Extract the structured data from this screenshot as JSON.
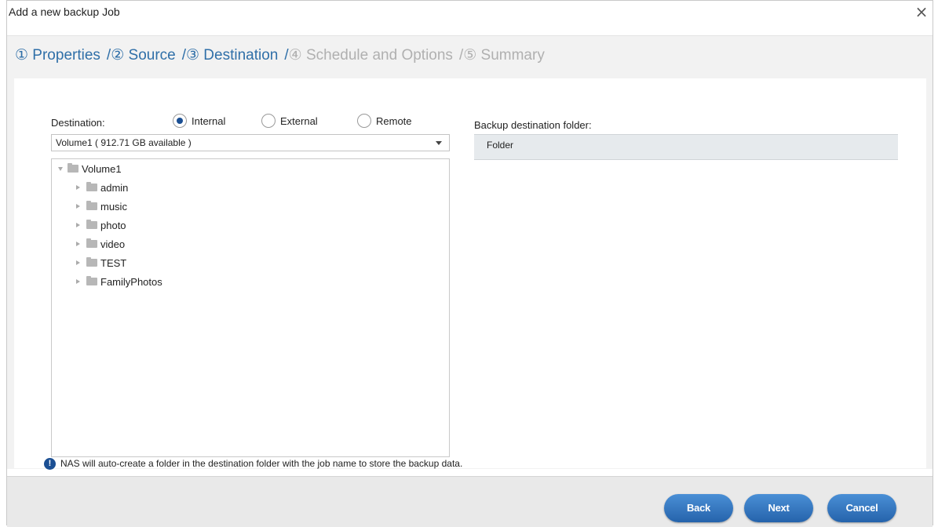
{
  "dialog": {
    "title": "Add a new backup Job",
    "close_symbol": "×"
  },
  "steps": [
    {
      "label": "① Properties",
      "state": "done"
    },
    {
      "label": "② Source",
      "state": "done"
    },
    {
      "label": "③ Destination",
      "state": "active"
    },
    {
      "label": "④ Schedule and Options",
      "state": "future"
    },
    {
      "label": "⑤ Summary",
      "state": "future"
    }
  ],
  "separator": "/",
  "destination": {
    "label": "Destination:",
    "options": [
      {
        "label": "Internal",
        "selected": true
      },
      {
        "label": "External",
        "selected": false
      },
      {
        "label": "Remote",
        "selected": false
      }
    ],
    "volume_select": "Volume1 ( 912.71 GB available )"
  },
  "tree": {
    "root": "Volume1",
    "children": [
      "admin",
      "music",
      "photo",
      "video",
      "TEST",
      "FamilyPhotos"
    ]
  },
  "backup_folder": {
    "label": "Backup destination folder:",
    "value": "Folder"
  },
  "info": {
    "icon": "!",
    "text": "NAS will auto-create a folder in the destination folder with the job name to store the backup data."
  },
  "buttons": {
    "back": "Back",
    "next": "Next",
    "cancel": "Cancel"
  },
  "colors": {
    "accent": "#2f6fa8",
    "button": "#2f72bd",
    "inactive_step": "#b0b0b0"
  }
}
